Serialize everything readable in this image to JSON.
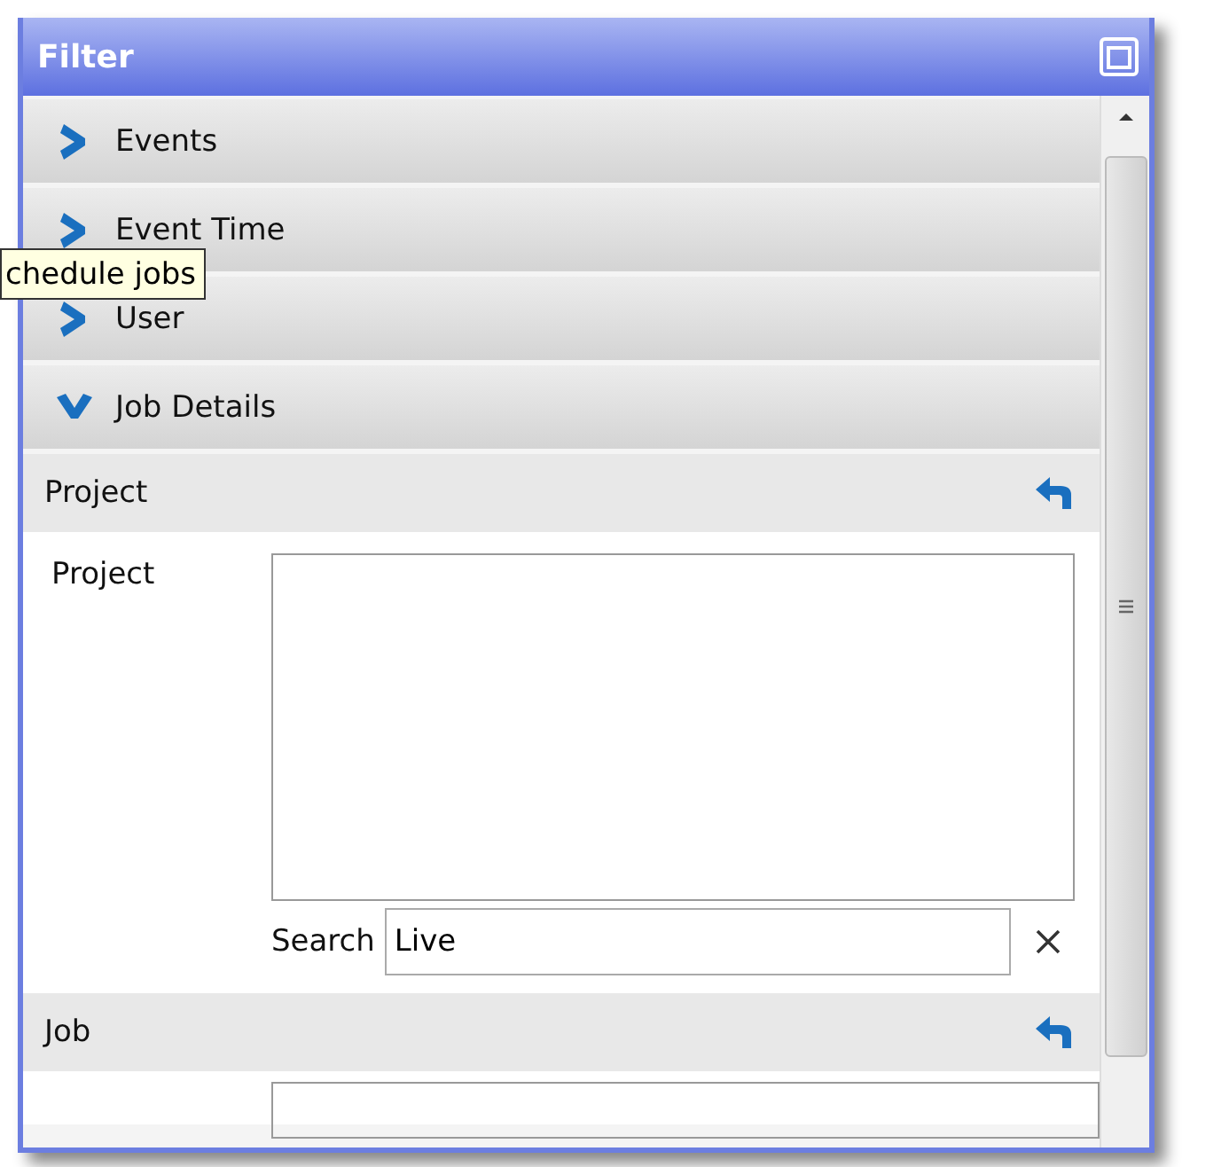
{
  "window": {
    "title": "Filter"
  },
  "sections": [
    {
      "label": "Events",
      "expanded": false
    },
    {
      "label": "Event Time",
      "expanded": false
    },
    {
      "label": "User",
      "expanded": false
    },
    {
      "label": "Job Details",
      "expanded": true
    }
  ],
  "groups": [
    {
      "title": "Project",
      "field_label": "Project",
      "search": {
        "label": "Search",
        "value": "Live"
      }
    },
    {
      "title": "Job"
    }
  ],
  "tooltip": {
    "text": "chedule jobs"
  }
}
